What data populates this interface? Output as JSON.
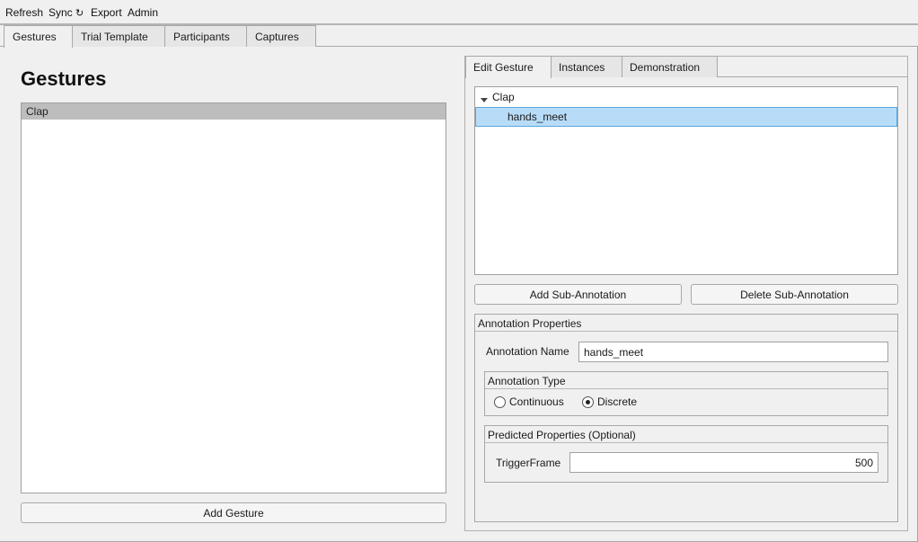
{
  "menu": {
    "refresh": "Refresh",
    "sync": "Sync",
    "sync_icon": "↻",
    "export": "Export",
    "admin": "Admin"
  },
  "tabs": [
    {
      "label": "Gestures"
    },
    {
      "label": "Trial Template"
    },
    {
      "label": "Participants"
    },
    {
      "label": "Captures"
    }
  ],
  "gestures": {
    "title": "Gestures",
    "items": [
      {
        "label": "Clap"
      }
    ],
    "add_button": "Add Gesture"
  },
  "right_tabs": [
    {
      "label": "Edit Gesture"
    },
    {
      "label": "Instances"
    },
    {
      "label": "Demonstration"
    }
  ],
  "tree": {
    "root": "Clap",
    "child": "hands_meet"
  },
  "buttons": {
    "add_sub": "Add Sub-Annotation",
    "delete_sub": "Delete Sub-Annotation"
  },
  "annotation_properties": {
    "title": "Annotation Properties",
    "name_label": "Annotation Name",
    "name_value": "hands_meet",
    "type_title": "Annotation Type",
    "continuous": "Continuous",
    "discrete": "Discrete"
  },
  "predicted": {
    "title": "Predicted Properties (Optional)",
    "trigger_label": "TriggerFrame",
    "trigger_value": "500"
  },
  "colors": {
    "selection_fill": "#b8dcf8",
    "selection_border": "#5aa6dc",
    "list_selection": "#bdbdbd"
  }
}
